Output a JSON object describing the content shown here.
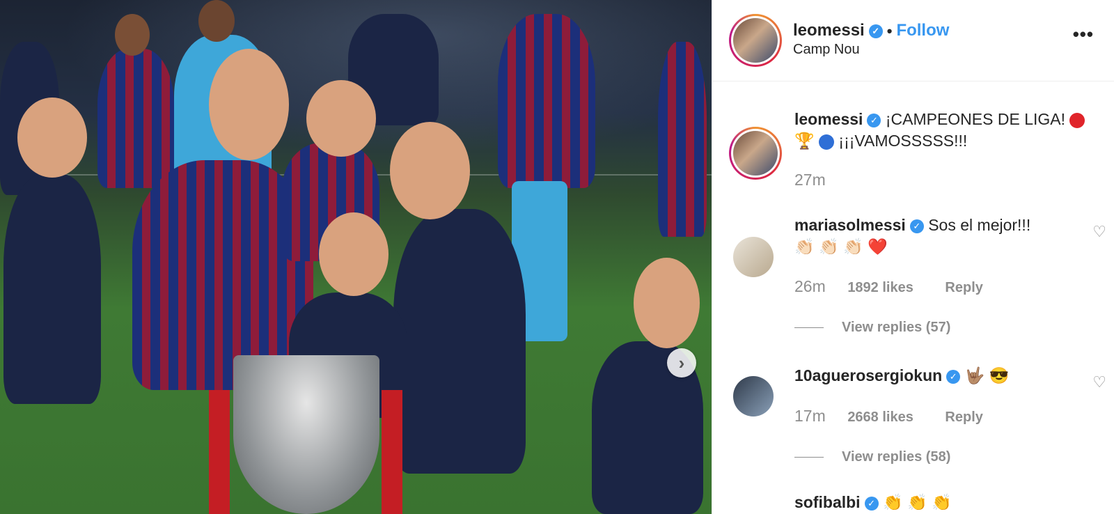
{
  "post": {
    "username": "leomessi",
    "separator": "•",
    "follow_label": "Follow",
    "location": "Camp Nou",
    "more_label": "•••",
    "next_label": "›"
  },
  "caption": {
    "username": "leomessi",
    "text_line1": "¡CAMPEONES DE LIGA!",
    "text_line2": "¡¡¡VAMOSSSSS!!!",
    "trophy_emoji": "🏆",
    "time": "27m"
  },
  "comments": [
    {
      "username": "mariasolmessi",
      "text": "Sos el mejor!!!",
      "emojis": "👏🏻 👏🏻 👏🏻",
      "heart_emoji": "❤️",
      "time": "26m",
      "likes": "1892 likes",
      "reply": "Reply",
      "view_replies": "View replies (57)"
    },
    {
      "username": "10aguerosergiokun",
      "text": "🤟🏽 😎",
      "time": "17m",
      "likes": "2668 likes",
      "reply": "Reply",
      "view_replies": "View replies (58)"
    },
    {
      "username": "sofibalbi",
      "text": "👏 👏 👏"
    }
  ],
  "icons": {
    "verified": "verified-badge-icon",
    "heart": "heart-outline-icon",
    "next": "chevron-right-icon",
    "more": "more-options-icon"
  },
  "colors": {
    "accent": "#3897f0",
    "text": "#262626",
    "muted": "#8e8e8e"
  }
}
